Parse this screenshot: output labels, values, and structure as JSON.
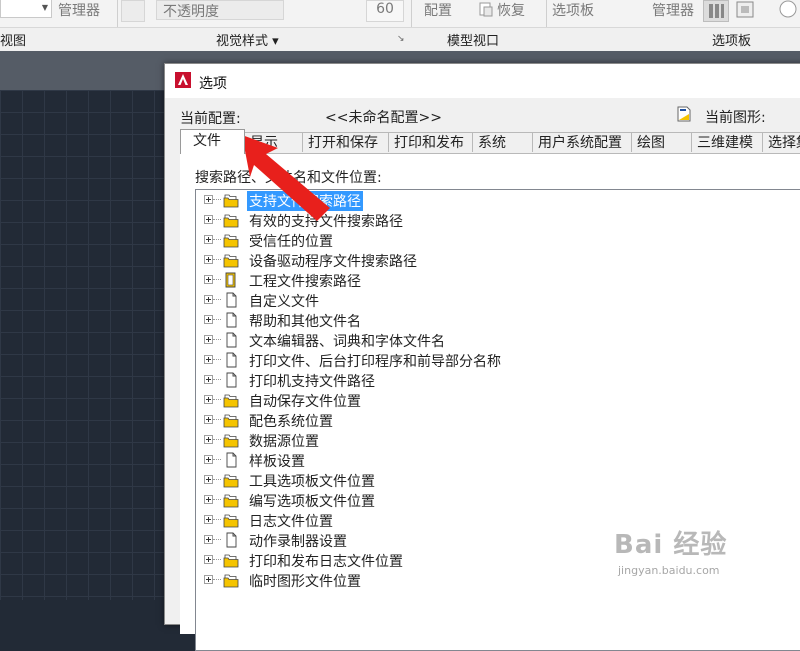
{
  "ribbon": {
    "top_items": {
      "manager1": "管理器",
      "transparency": "不透明度",
      "transparency_value": "60",
      "config": "配置",
      "restore": "恢复",
      "palettes_top": "选项板",
      "manager2": "管理器"
    },
    "panel_labels": {
      "view": "视图",
      "visual_styles": "视觉样式 ▾",
      "model_viewports": "模型视口",
      "palettes": "选项板"
    }
  },
  "dialog": {
    "title": "选项",
    "current_profile_label": "当前配置:",
    "current_profile_value": "<<未命名配置>>",
    "current_drawing_label": "当前图形:",
    "tabs": [
      "文件",
      "显示",
      "打开和保存",
      "打印和发布",
      "系统",
      "用户系统配置",
      "绘图",
      "三维建模",
      "选择集"
    ],
    "active_tab": "文件",
    "search_paths_label": "搜索路径、文件名和文件位置:",
    "tree_items": [
      {
        "label": "支持文件搜索路径",
        "icon": "folder-stack-icon",
        "selected": true
      },
      {
        "label": "有效的支持文件搜索路径",
        "icon": "folder-stack-icon"
      },
      {
        "label": "受信任的位置",
        "icon": "folder-stack-icon"
      },
      {
        "label": "设备驱动程序文件搜索路径",
        "icon": "folder-stack-icon"
      },
      {
        "label": "工程文件搜索路径",
        "icon": "project-file-icon"
      },
      {
        "label": "自定义文件",
        "icon": "document-icon"
      },
      {
        "label": "帮助和其他文件名",
        "icon": "document-icon"
      },
      {
        "label": "文本编辑器、词典和字体文件名",
        "icon": "document-icon"
      },
      {
        "label": "打印文件、后台打印程序和前导部分名称",
        "icon": "document-icon"
      },
      {
        "label": "打印机支持文件路径",
        "icon": "document-icon"
      },
      {
        "label": "自动保存文件位置",
        "icon": "folder-stack-icon"
      },
      {
        "label": "配色系统位置",
        "icon": "folder-stack-icon"
      },
      {
        "label": "数据源位置",
        "icon": "folder-stack-icon"
      },
      {
        "label": "样板设置",
        "icon": "document-icon"
      },
      {
        "label": "工具选项板文件位置",
        "icon": "folder-stack-icon"
      },
      {
        "label": "编写选项板文件位置",
        "icon": "folder-stack-icon"
      },
      {
        "label": "日志文件位置",
        "icon": "folder-stack-icon"
      },
      {
        "label": "动作录制器设置",
        "icon": "document-icon"
      },
      {
        "label": "打印和发布日志文件位置",
        "icon": "folder-stack-icon"
      },
      {
        "label": "临时图形文件位置",
        "icon": "folder-stack-icon"
      }
    ]
  },
  "watermark": {
    "logo_text": "Bai 经验",
    "url": "jingyan.baidu.com"
  },
  "colors": {
    "selection": "#3399ff",
    "annotation_arrow": "#e8201c",
    "folder": "#f5c400",
    "canvas_bg": "#222a36",
    "app_icon_red": "#c8102e"
  }
}
